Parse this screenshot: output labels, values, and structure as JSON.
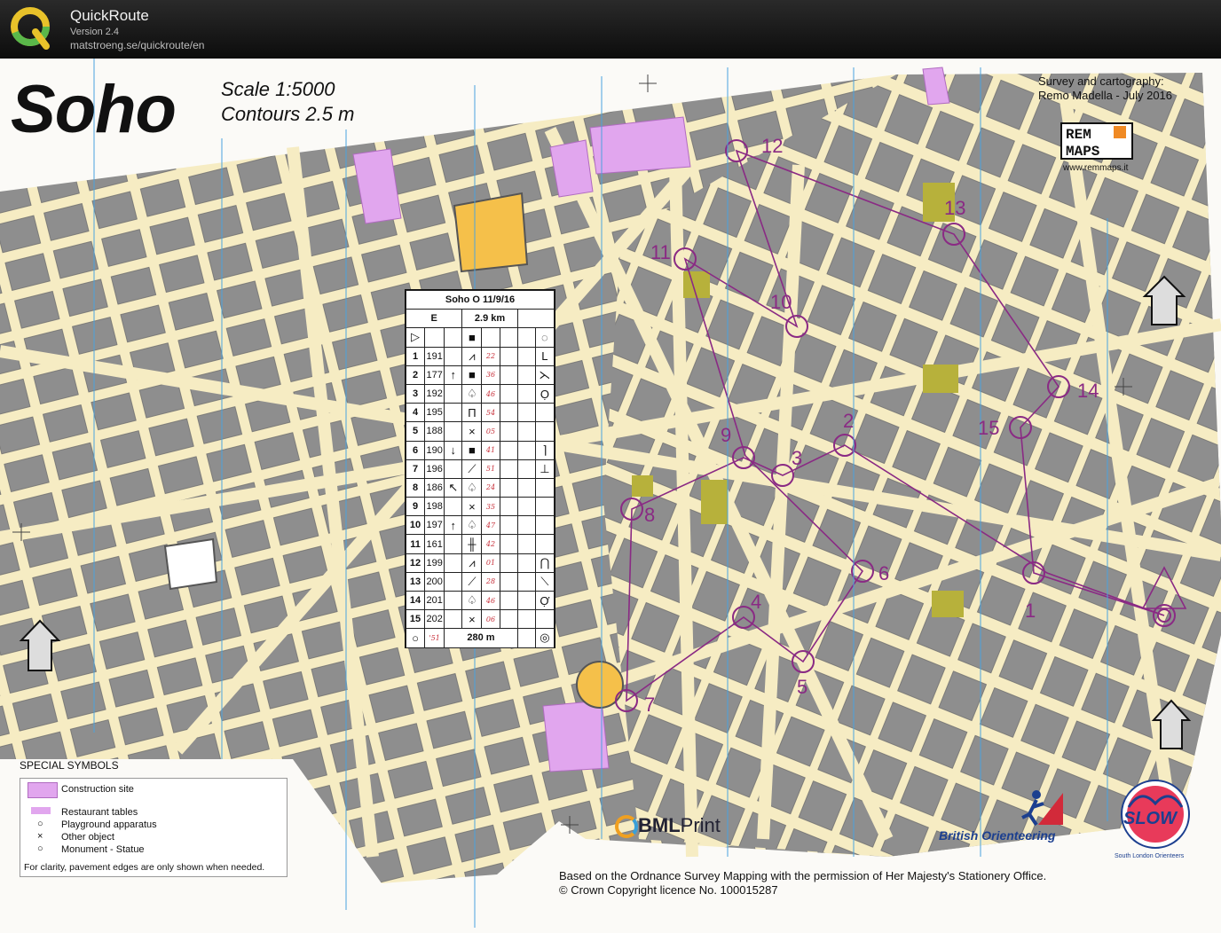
{
  "app": {
    "name": "QuickRoute",
    "version": "Version 2.4",
    "url": "matstroeng.se/quickroute/en"
  },
  "map": {
    "title": "Soho",
    "scale": "Scale    1:5000",
    "contours": "Contours 2.5 m",
    "survey_line1": "Survey and cartography:",
    "survey_line2": "Remo Madella - July 2016",
    "remmaps_url": "www.remmaps.it",
    "copyright_line1": "Based on the Ordnance Survey Mapping with the permission of Her Majesty's Stationery Office.",
    "copyright_line2": "© Crown Copyright licence No. 100015287",
    "sponsor1_a": "BML",
    "sponsor1_b": "Print",
    "sponsor2": "British Orienteering",
    "sponsor3": "SLOW",
    "sponsor3_sub": "South London Orienteers",
    "colors": {
      "building": "#8e8e8e",
      "paved": "#f6ecc3",
      "course": "#8a2a84",
      "construction": "#e1a6ee",
      "green": "#7dce62"
    }
  },
  "control_description": {
    "event": "Soho O",
    "date_handwritten": "11/9/16",
    "course": "E",
    "length": "2.9 km",
    "finish_distance": "280 m",
    "finish_handwritten": "'51",
    "controls": [
      {
        "n": "1",
        "code": "191",
        "c": "",
        "d": "⩘",
        "g": "",
        "l": "L",
        "hw": "22"
      },
      {
        "n": "2",
        "code": "177",
        "c": "↑",
        "d": "■",
        "g": "",
        "l": "⋋",
        "hw": "36"
      },
      {
        "n": "3",
        "code": "192",
        "c": "",
        "d": "♤",
        "g": "",
        "l": "Ọ",
        "hw": "46"
      },
      {
        "n": "4",
        "code": "195",
        "c": "",
        "d": "П",
        "g": "",
        "l": "",
        "hw": "54"
      },
      {
        "n": "5",
        "code": "188",
        "c": "",
        "d": "×",
        "g": "",
        "l": "",
        "hw": "05"
      },
      {
        "n": "6",
        "code": "190",
        "c": "↓",
        "d": "■",
        "g": "",
        "l": "⌉",
        "hw": "41"
      },
      {
        "n": "7",
        "code": "196",
        "c": "",
        "d": "⟋",
        "g": "",
        "l": "⊥",
        "hw": "51"
      },
      {
        "n": "8",
        "code": "186",
        "c": "↖",
        "d": "♤",
        "g": "",
        "l": "",
        "hw": "24"
      },
      {
        "n": "9",
        "code": "198",
        "c": "",
        "d": "×",
        "g": "",
        "l": "",
        "hw": "35"
      },
      {
        "n": "10",
        "code": "197",
        "c": "↑",
        "d": "♤",
        "g": "",
        "l": "",
        "hw": "47"
      },
      {
        "n": "11",
        "code": "161",
        "c": "",
        "d": "╫",
        "g": "",
        "l": "",
        "hw": "42"
      },
      {
        "n": "12",
        "code": "199",
        "c": "",
        "d": "⩘",
        "g": "",
        "l": "⋂",
        "hw": "01"
      },
      {
        "n": "13",
        "code": "200",
        "c": "",
        "d": "⟋",
        "g": "",
        "l": "⟍",
        "hw": "28"
      },
      {
        "n": "14",
        "code": "201",
        "c": "",
        "d": "♤",
        "g": "",
        "l": "Ợ",
        "hw": "46"
      },
      {
        "n": "15",
        "code": "202",
        "c": "",
        "d": "×",
        "g": "",
        "l": "",
        "hw": "06"
      }
    ]
  },
  "legend": {
    "title": "SPECIAL SYMBOLS",
    "items": [
      {
        "label": "Construction site"
      },
      {
        "label": "Restaurant tables"
      },
      {
        "label": "Playground apparatus"
      },
      {
        "label": "Other object"
      },
      {
        "label": "Monument - Statue"
      }
    ],
    "note": "For clarity, pavement edges are only shown when needed."
  },
  "course_controls": [
    {
      "label": "1"
    },
    {
      "label": "2"
    },
    {
      "label": "3"
    },
    {
      "label": "4"
    },
    {
      "label": "5"
    },
    {
      "label": "6"
    },
    {
      "label": "7"
    },
    {
      "label": "8"
    },
    {
      "label": "9"
    },
    {
      "label": "10"
    },
    {
      "label": "11"
    },
    {
      "label": "12"
    },
    {
      "label": "13"
    },
    {
      "label": "14"
    },
    {
      "label": "15"
    }
  ]
}
